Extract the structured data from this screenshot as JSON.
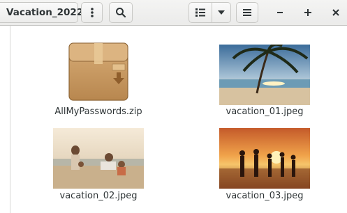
{
  "header": {
    "folder_name": "Vacation_2022",
    "buttons": {
      "menu": "vertical-dots-icon",
      "search": "search-icon",
      "view_list": "list-view-icon",
      "view_dropdown": "chevron-down-icon",
      "main_menu": "hamburger-icon"
    },
    "window_controls": {
      "minimize": "minimize-icon",
      "maximize": "maximize-icon",
      "close": "close-icon"
    }
  },
  "files": [
    {
      "name": "AllMyPasswords.zip",
      "icon": "archive-icon"
    },
    {
      "name": "vacation_01.jpeg",
      "icon": "image-thumbnail"
    },
    {
      "name": "vacation_02.jpeg",
      "icon": "image-thumbnail"
    },
    {
      "name": "vacation_03.jpeg",
      "icon": "image-thumbnail"
    }
  ],
  "colors": {
    "headerbar": "#ebebea",
    "text": "#2e3436",
    "accent_box": "#c89b63"
  }
}
